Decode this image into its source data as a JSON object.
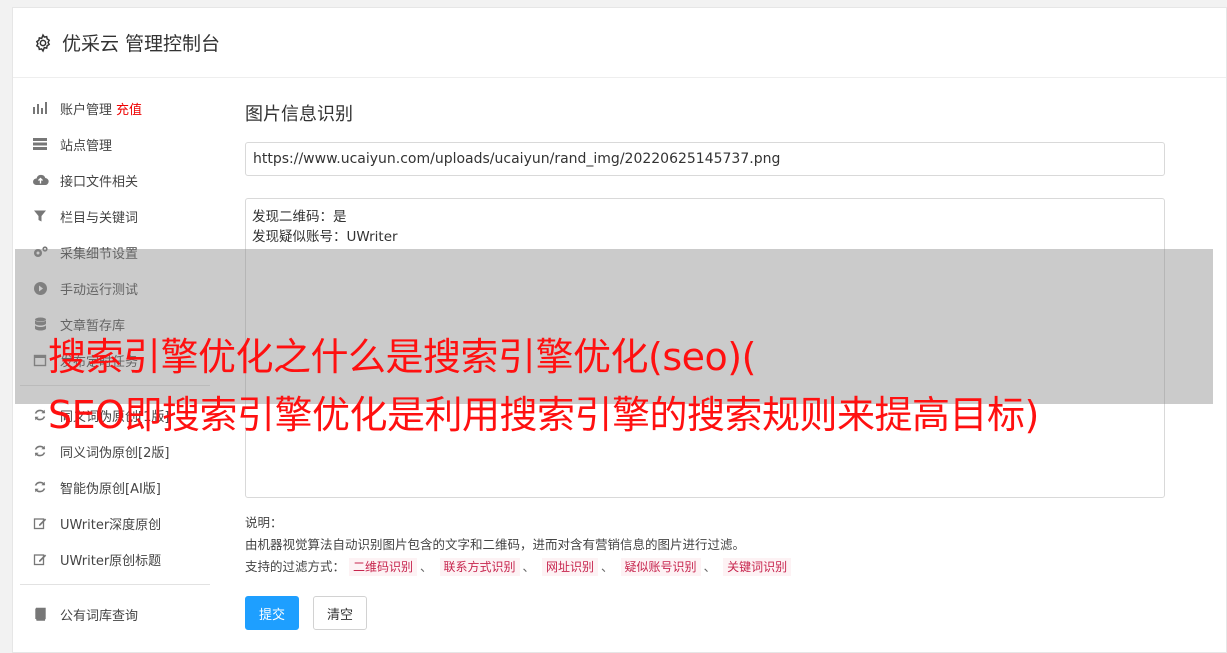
{
  "header": {
    "title": "优采云 管理控制台",
    "icon": "gear-icon"
  },
  "sidebar": {
    "items": [
      {
        "label": "账户管理",
        "badge": "充值",
        "icon": "bar-chart-icon"
      },
      {
        "label": "站点管理",
        "icon": "server-icon"
      },
      {
        "label": "接口文件相关",
        "icon": "cloud-upload-icon"
      },
      {
        "label": "栏目与关键词",
        "icon": "filter-icon"
      },
      {
        "label": "采集细节设置",
        "icon": "cogs-icon"
      },
      {
        "label": "手动运行测试",
        "icon": "play-circle-icon"
      },
      {
        "label": "文章暂存库",
        "icon": "database-icon"
      },
      {
        "label": "发布定时任务",
        "icon": "calendar-icon"
      },
      {
        "label": "同义词伪原创[1版]",
        "icon": "refresh-icon"
      },
      {
        "label": "同义词伪原创[2版]",
        "icon": "refresh-icon"
      },
      {
        "label": "智能伪原创[AI版]",
        "icon": "refresh-icon"
      },
      {
        "label": "UWriter深度原创",
        "icon": "edit-icon"
      },
      {
        "label": "UWriter原创标题",
        "icon": "edit-icon"
      }
    ],
    "bottom_items": [
      {
        "label": "公有词库查询",
        "icon": "book-icon"
      }
    ]
  },
  "main": {
    "title": "图片信息识别",
    "url_value": "https://www.ucaiyun.com/uploads/ucaiyun/rand_img/20220625145737.png",
    "result_lines": [
      "发现二维码：是",
      "发现疑似账号：UWriter"
    ],
    "notes_label": "说明：",
    "notes_text": "由机器视觉算法自动识别图片包含的文字和二维码，进而对含有营销信息的图片进行过滤。",
    "filter_label": "支持的过滤方式：",
    "filter_tags": [
      "二维码识别",
      "联系方式识别",
      "网址识别",
      "疑似账号识别",
      "关键词识别"
    ],
    "filter_sep": "、",
    "submit_label": "提交",
    "clear_label": "清空"
  },
  "overlay": {
    "line1": "搜索引擎优化之什么是搜索引擎优化(seo)(",
    "line2": "SEO即搜索引擎优化是利用搜索引擎的搜索规则来提高目标)"
  },
  "colors": {
    "accent": "#1e9fff",
    "badge": "#e00000",
    "overlay_text": "#ff1010",
    "tag_text": "#c7254e"
  }
}
